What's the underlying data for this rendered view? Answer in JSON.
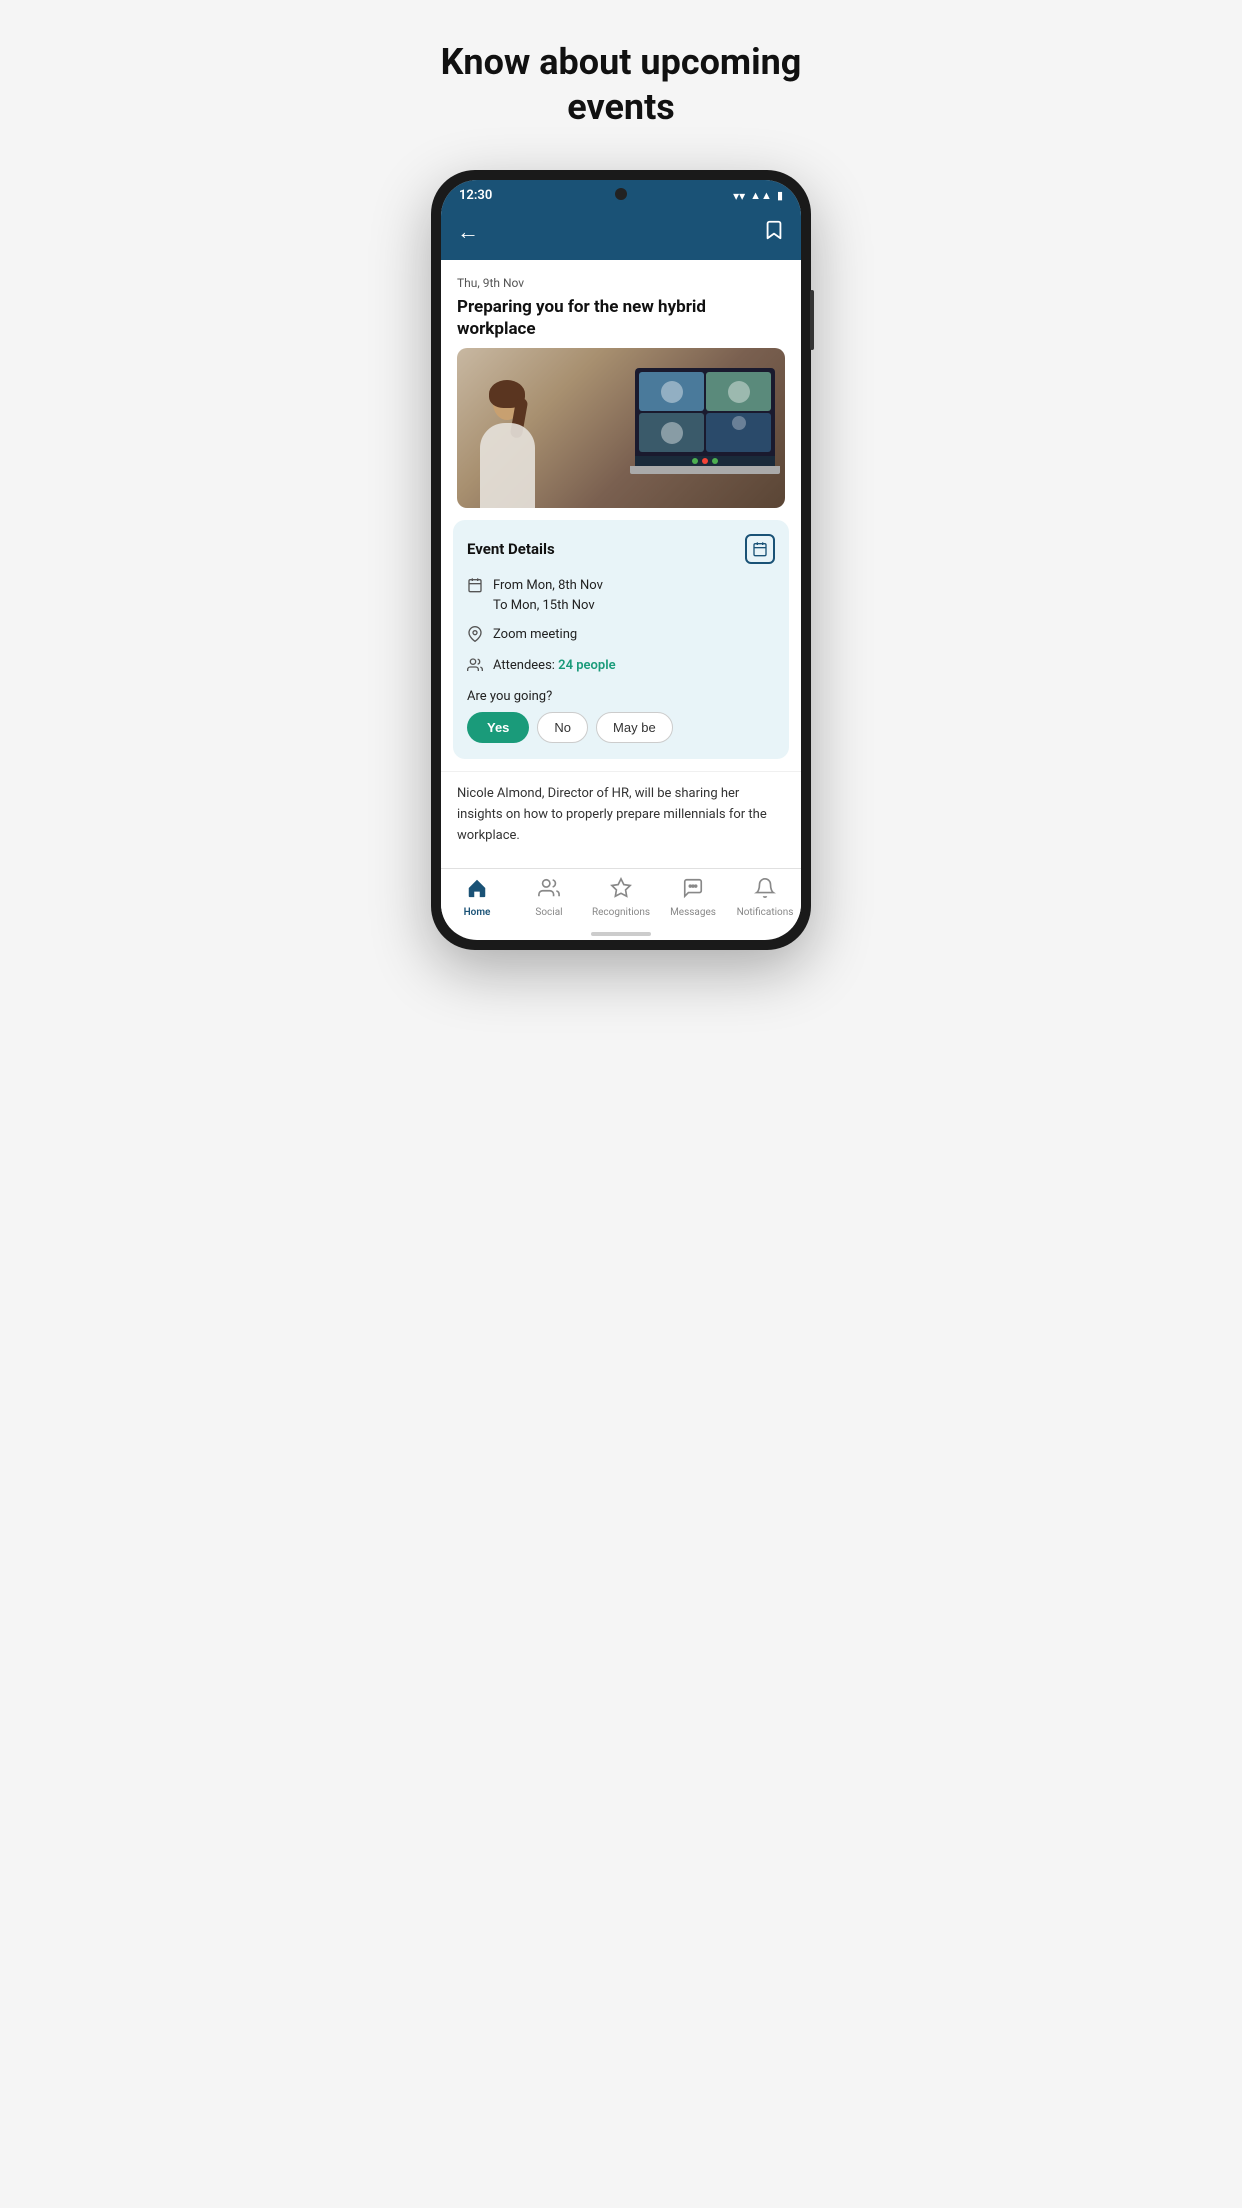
{
  "page": {
    "title": "Know about upcoming events"
  },
  "status_bar": {
    "time": "12:30",
    "icons": [
      "wifi",
      "signal",
      "battery"
    ]
  },
  "header": {
    "back_label": "←",
    "bookmark_label": "🔖"
  },
  "event": {
    "date": "Thu, 9th Nov",
    "title": "Preparing you for the new hybrid workplace",
    "details": {
      "section_title": "Event Details",
      "date_from": "From Mon, 8th Nov",
      "date_to": "To Mon, 15th Nov",
      "location": "Zoom meeting",
      "attendees_prefix": "Attendees: ",
      "attendees_count": "24 people",
      "going_question": "Are you going?",
      "btn_yes": "Yes",
      "btn_no": "No",
      "btn_maybe": "May be"
    },
    "description": "Nicole Almond, Director of HR, will be sharing her insights on how to properly prepare millennials for the workplace."
  },
  "bottom_nav": {
    "items": [
      {
        "id": "home",
        "label": "Home",
        "active": true
      },
      {
        "id": "social",
        "label": "Social",
        "active": false
      },
      {
        "id": "recognitions",
        "label": "Recognitions",
        "active": false
      },
      {
        "id": "messages",
        "label": "Messages",
        "active": false
      },
      {
        "id": "notifications",
        "label": "Notifications",
        "active": false
      }
    ]
  },
  "colors": {
    "header_bg": "#1a5276",
    "accent_green": "#1a9b7a",
    "card_bg": "#e8f4f8",
    "active_nav": "#1a5276"
  }
}
